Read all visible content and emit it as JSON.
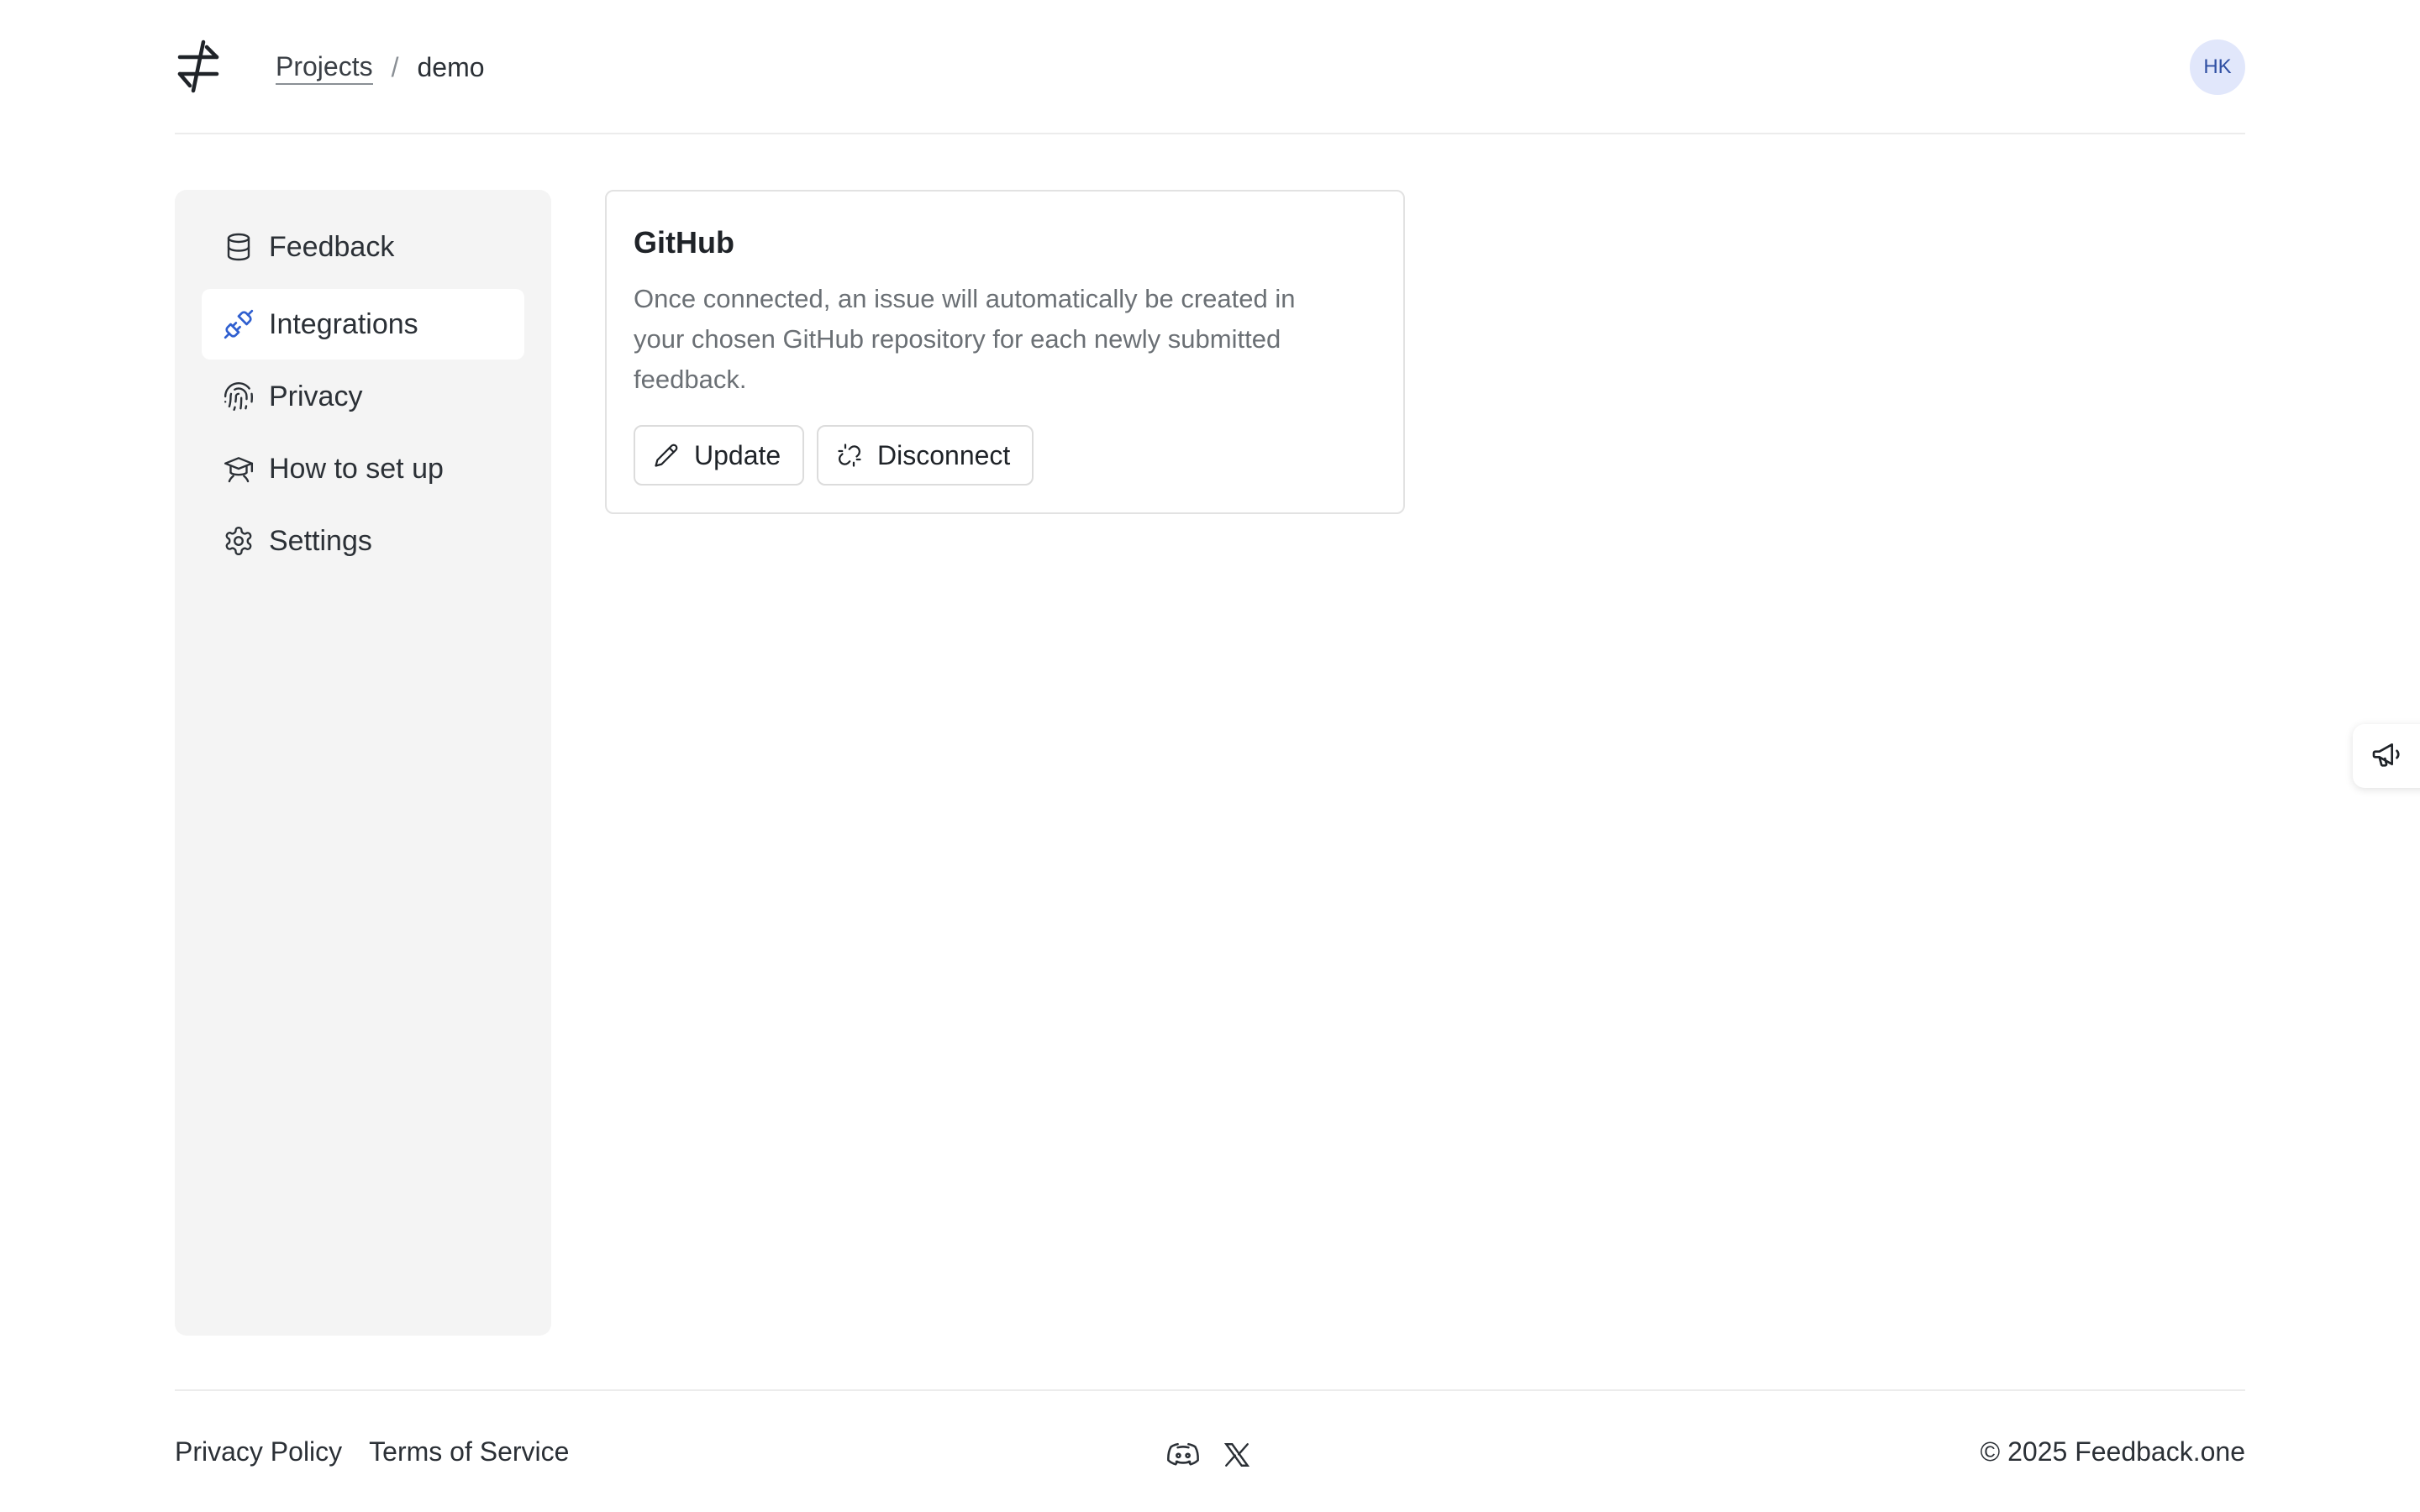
{
  "header": {
    "logo_icon": "arrows-swap-logo-icon",
    "breadcrumb": {
      "link": "Projects",
      "separator": "/",
      "current": "demo"
    },
    "avatar_initials": "HK"
  },
  "sidebar": {
    "items": [
      {
        "label": "Feedback",
        "icon": "database-icon",
        "active": false
      },
      {
        "label": "Integrations",
        "icon": "plug-icon",
        "active": true
      },
      {
        "label": "Privacy",
        "icon": "fingerprint-icon",
        "active": false
      },
      {
        "label": "How to set up",
        "icon": "graduation-cap-icon",
        "active": false
      },
      {
        "label": "Settings",
        "icon": "gear-icon",
        "active": false
      }
    ]
  },
  "integration_card": {
    "title": "GitHub",
    "description": "Once connected, an issue will automatically be created in your chosen GitHub repository for each newly submitted feedback.",
    "update_label": "Update",
    "disconnect_label": "Disconnect"
  },
  "floating_tab": {
    "icon": "megaphone-icon"
  },
  "footer": {
    "privacy_label": "Privacy Policy",
    "terms_label": "Terms of Service",
    "socials": [
      "discord-icon",
      "x-icon"
    ],
    "copyright": "© 2025 Feedback.one"
  },
  "colors": {
    "accent": "#2f5fd0",
    "avatar_bg": "#e1e7fb",
    "sidebar_bg": "#f4f4f4"
  }
}
